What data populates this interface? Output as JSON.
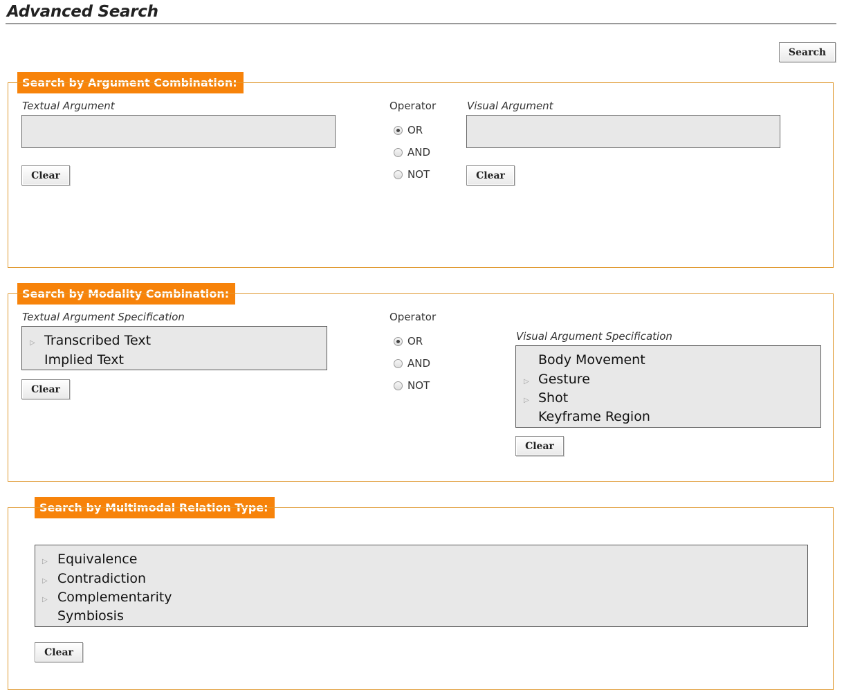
{
  "page": {
    "title": "Advanced Search"
  },
  "toolbar": {
    "search_label": "Search"
  },
  "argument_combination": {
    "legend": "Search by Argument Combination:",
    "textual_label": "Textual Argument",
    "operator_label": "Operator",
    "visual_label": "Visual Argument",
    "textual_value": "",
    "visual_value": "",
    "operators": [
      "OR",
      "AND",
      "NOT"
    ],
    "selected_operator": "OR",
    "clear_label": "Clear"
  },
  "modality_combination": {
    "legend": "Search by Modality Combination:",
    "textual_label": "Textual Argument Specification",
    "operator_label": "Operator",
    "visual_label": "Visual Argument Specification",
    "textual_items": [
      {
        "label": "Transcribed Text",
        "expandable": true
      },
      {
        "label": "Implied Text",
        "expandable": false
      }
    ],
    "visual_items": [
      {
        "label": "Body Movement",
        "expandable": false
      },
      {
        "label": "Gesture",
        "expandable": true
      },
      {
        "label": "Shot",
        "expandable": true
      },
      {
        "label": "Keyframe Region",
        "expandable": false
      }
    ],
    "operators": [
      "OR",
      "AND",
      "NOT"
    ],
    "selected_operator": "OR",
    "clear_label": "Clear"
  },
  "relation_type": {
    "legend": "Search by Multimodal Relation Type:",
    "items": [
      {
        "label": "Equivalence",
        "expandable": true
      },
      {
        "label": "Contradiction",
        "expandable": true
      },
      {
        "label": "Complementarity",
        "expandable": true
      },
      {
        "label": "Symbiosis",
        "expandable": false
      }
    ],
    "clear_label": "Clear"
  },
  "icons": {
    "expand": "triangle-right-icon",
    "radio": "radio-icon"
  },
  "colors": {
    "accent": "#f7830a",
    "panel_border": "#e09a33",
    "field_bg": "#e8e8e8"
  }
}
